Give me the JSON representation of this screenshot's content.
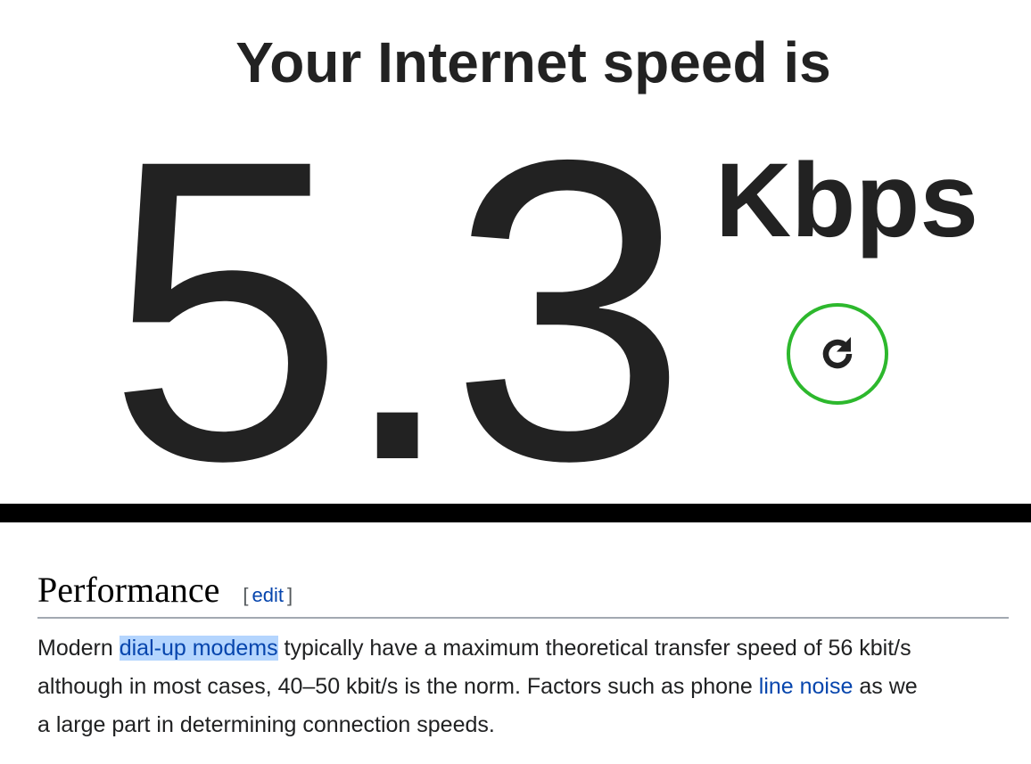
{
  "speedtest": {
    "title": "Your Internet speed is",
    "value": "5.3",
    "unit": "Kbps",
    "restart_icon": "restart-icon",
    "accent_color": "#2db82d"
  },
  "wiki": {
    "heading": "Performance",
    "edit_open": "[",
    "edit_label": "edit",
    "edit_close": "]",
    "paragraph": {
      "line1_pre": "Modern ",
      "line1_link": "dial-up modems",
      "line1_post": " typically have a maximum theoretical transfer speed of 56 kbit/s",
      "line2_pre": "although in most cases, 40–50 kbit/s is the norm. Factors such as phone ",
      "line2_link": "line noise",
      "line2_post": " as we",
      "line3": "a large part in determining connection speeds."
    },
    "link_color": "#0645ad",
    "selection_color": "#b4d5fe"
  }
}
